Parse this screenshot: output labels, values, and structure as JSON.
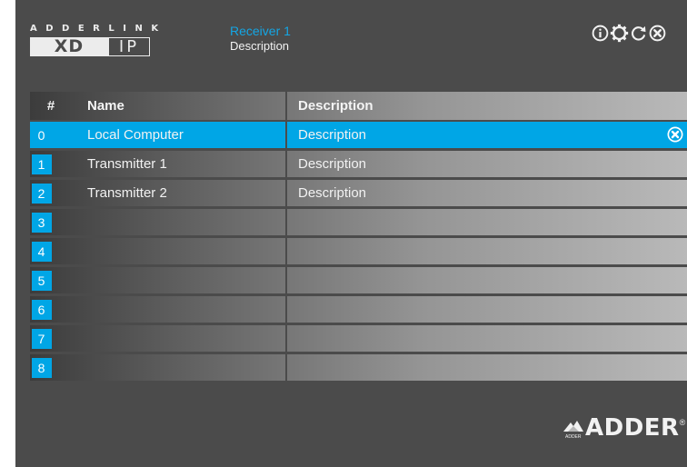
{
  "logo": {
    "top_text": "ADDERLINK",
    "xd_text": "XD",
    "ip_text": "IP"
  },
  "header": {
    "receiver_name": "Receiver 1",
    "receiver_description": "Description"
  },
  "toolbar": {
    "icons": [
      "info-icon",
      "gear-icon",
      "refresh-icon",
      "close-icon"
    ]
  },
  "table": {
    "columns": {
      "num": "#",
      "name": "Name",
      "description": "Description"
    },
    "rows": [
      {
        "num": "0",
        "name": "Local Computer",
        "description": "Description",
        "selected": true
      },
      {
        "num": "1",
        "name": "Transmitter 1",
        "description": "Description",
        "selected": false
      },
      {
        "num": "2",
        "name": "Transmitter 2",
        "description": "Description",
        "selected": false
      },
      {
        "num": "3",
        "name": "",
        "description": "",
        "selected": false
      },
      {
        "num": "4",
        "name": "",
        "description": "",
        "selected": false
      },
      {
        "num": "5",
        "name": "",
        "description": "",
        "selected": false
      },
      {
        "num": "6",
        "name": "",
        "description": "",
        "selected": false
      },
      {
        "num": "7",
        "name": "",
        "description": "",
        "selected": false
      },
      {
        "num": "8",
        "name": "",
        "description": "",
        "selected": false
      }
    ]
  },
  "brand": {
    "name": "ADDER",
    "sub": "ADDER",
    "registered": "®"
  },
  "colors": {
    "accent": "#00a6e6",
    "panel": "#4b4b4b",
    "text": "#f2f2f2"
  }
}
